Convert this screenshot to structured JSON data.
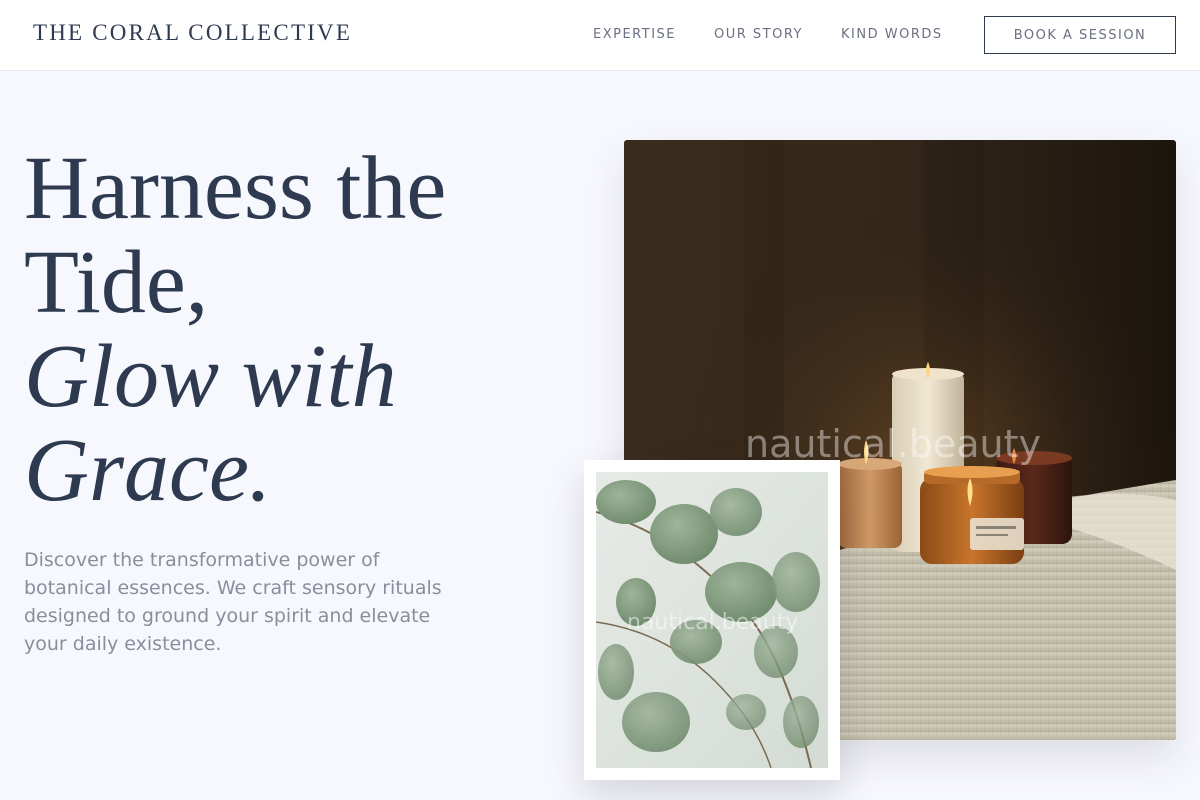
{
  "header": {
    "brand": "THE CORAL COLLECTIVE",
    "nav": [
      {
        "label": "EXPERTISE"
      },
      {
        "label": "OUR STORY"
      },
      {
        "label": "KIND WORDS"
      }
    ],
    "cta_label": "BOOK A SESSION"
  },
  "hero": {
    "headline": {
      "line1": "Harness the",
      "line2": "Tide,",
      "line3": "Glow with",
      "line4": "Grace."
    },
    "description": "Discover the transformative power of botanical essences. We craft sensory rituals designed to ground your spirit and elevate your daily existence.",
    "images": {
      "main_watermark": "nautical.beauty",
      "secondary_watermark": "nautical.beauty"
    }
  },
  "colors": {
    "heading": "#2d3a4f",
    "body_text": "#8a8e9c",
    "nav_text": "#6b7080",
    "page_background": "#f7f8fd"
  }
}
